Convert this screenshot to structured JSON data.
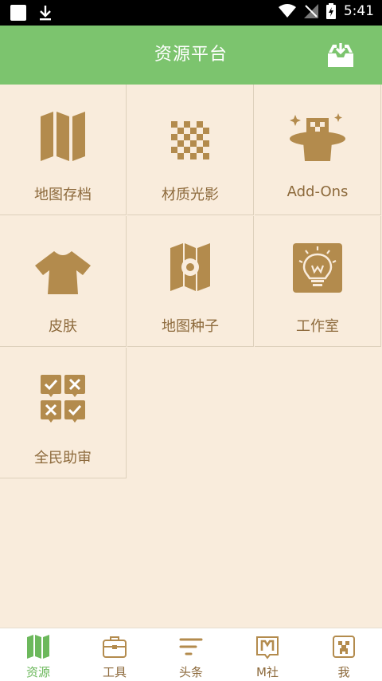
{
  "status_bar": {
    "time": "5:41"
  },
  "header": {
    "title": "资源平台"
  },
  "grid": {
    "items": [
      {
        "label": "地图存档",
        "icon": "folded-map-icon"
      },
      {
        "label": "材质光影",
        "icon": "checkerboard-icon"
      },
      {
        "label": "Add-Ons",
        "icon": "magic-hat-icon"
      },
      {
        "label": "皮肤",
        "icon": "tshirt-icon"
      },
      {
        "label": "地图种子",
        "icon": "map-seed-icon"
      },
      {
        "label": "工作室",
        "icon": "studio-lightbulb-icon"
      },
      {
        "label": "全民助审",
        "icon": "review-checklist-icon"
      }
    ]
  },
  "tabs": [
    {
      "label": "资源",
      "icon": "map-icon",
      "active": true
    },
    {
      "label": "工具",
      "icon": "toolbox-icon",
      "active": false
    },
    {
      "label": "头条",
      "icon": "headlines-icon",
      "active": false
    },
    {
      "label": "M社",
      "icon": "m-community-icon",
      "active": false
    },
    {
      "label": "我",
      "icon": "creeper-face-icon",
      "active": false
    }
  ],
  "colors": {
    "accent": "#7cc46e",
    "icon_brown": "#b38b4d",
    "background": "#f9ecdc",
    "text_brown": "#8d6a3c"
  }
}
